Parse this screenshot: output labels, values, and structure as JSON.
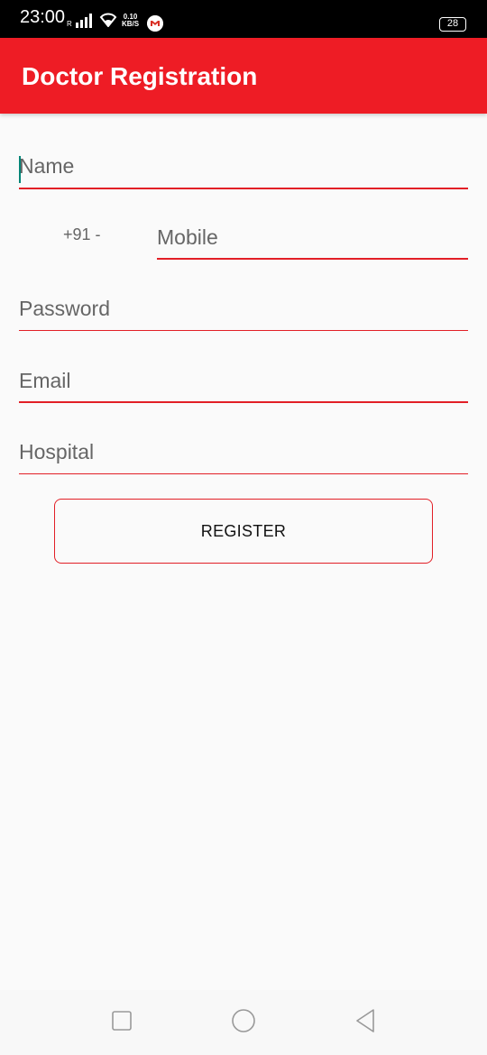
{
  "status_bar": {
    "time": "23:00",
    "signal_label": "R",
    "speed_value": "0.10",
    "speed_unit": "KB/S",
    "battery": "28",
    "icons": [
      "signal-icon",
      "wifi-icon",
      "gmail-icon",
      "battery-icon"
    ]
  },
  "app_bar": {
    "title": "Doctor Registration",
    "color": "#ee1c25"
  },
  "form": {
    "name_placeholder": "Name",
    "mobile_prefix": "+91 -",
    "mobile_placeholder": "Mobile",
    "password_placeholder": "Password",
    "email_placeholder": "Email",
    "hospital_placeholder": "Hospital",
    "register_label": "REGISTER",
    "accent_color": "#e21f26",
    "cursor_color": "#008577"
  },
  "nav_bar": {
    "icons": [
      "recents-square-icon",
      "home-circle-icon",
      "back-triangle-icon"
    ]
  }
}
